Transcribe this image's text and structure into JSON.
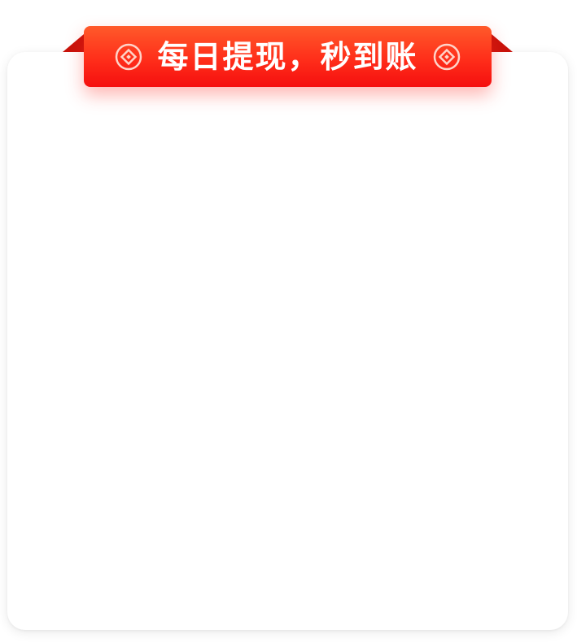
{
  "banner": {
    "text": "每日提现，秒到账",
    "left_icon": "coin-diamond-icon",
    "right_icon": "coin-diamond-icon"
  },
  "colors": {
    "ribbon_top": "#ff5a2a",
    "ribbon_bottom": "#f50f0f",
    "ribbon_fold": "#c8120a",
    "card_background": "#ffffff",
    "text": "#ffffff"
  }
}
